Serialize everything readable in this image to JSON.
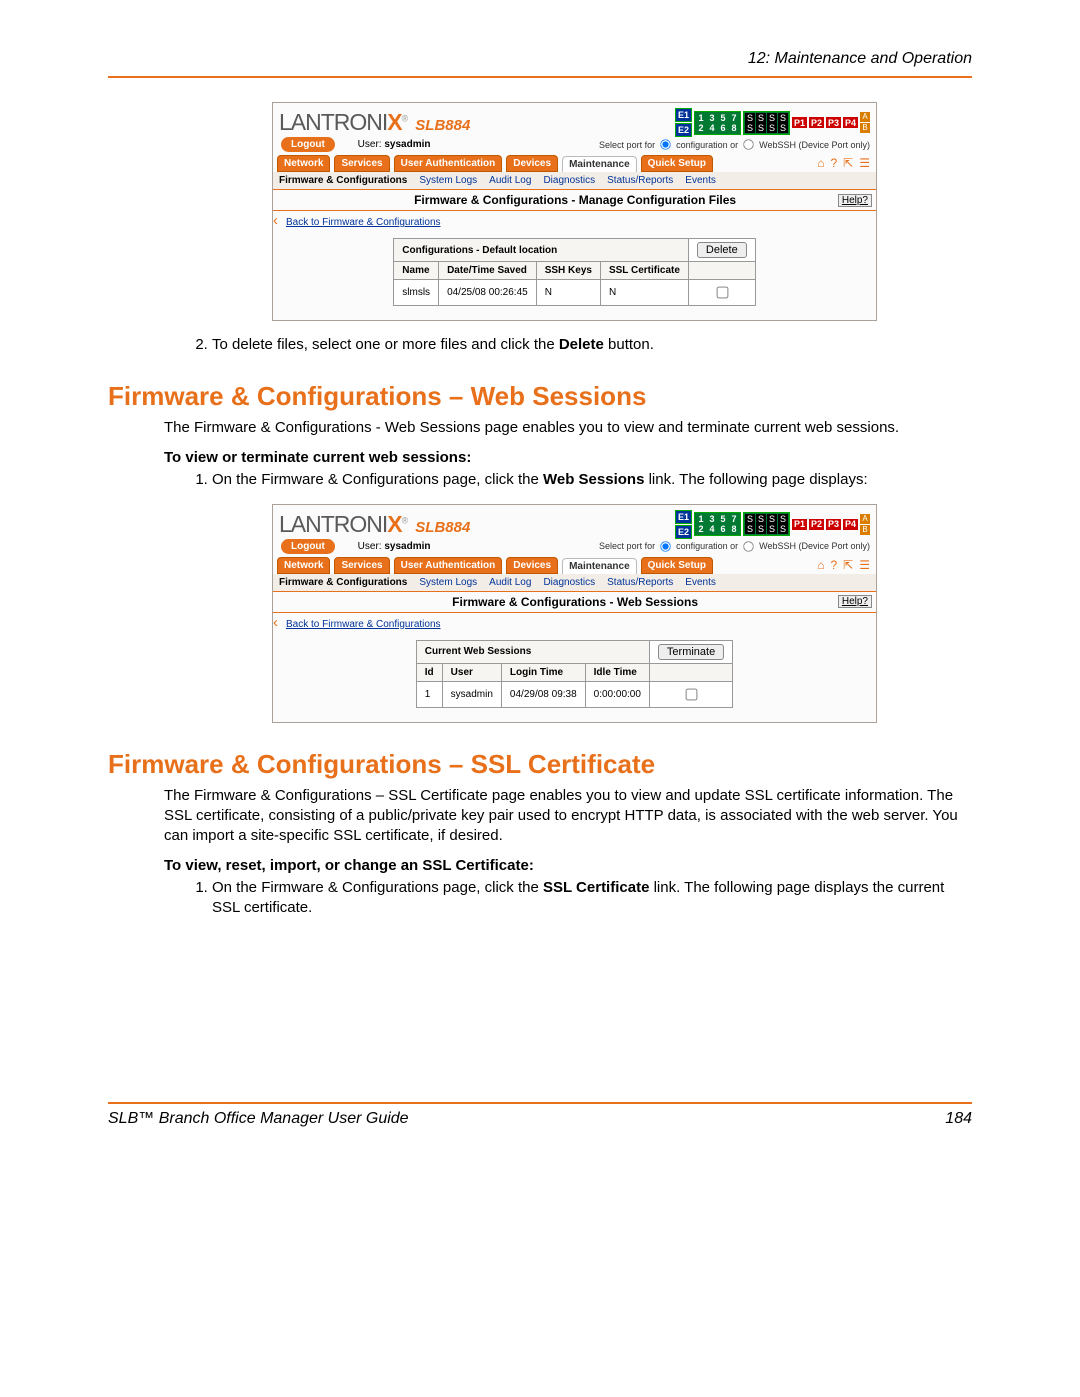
{
  "header": {
    "chapter": "12: Maintenance and Operation"
  },
  "footer": {
    "title": "SLB™ Branch Office Manager User Guide",
    "page": "184"
  },
  "fig1": {
    "brand": "LANTRONI",
    "brand_suffix": "X",
    "model": "SLB884",
    "e": [
      "E1",
      "E2"
    ],
    "ports_odd": [
      "1",
      "3",
      "5",
      "7"
    ],
    "ports_even": [
      "2",
      "4",
      "6",
      "8"
    ],
    "s_row": [
      "S",
      "S",
      "S",
      "S"
    ],
    "p_ports": [
      "P1",
      "P2",
      "P3",
      "P4"
    ],
    "ab": [
      "A",
      "B"
    ],
    "logout": "Logout",
    "user_prefix": "User:",
    "user": "sysadmin",
    "portselect_prefix": "Select port for",
    "portselect_opt1": "configuration or",
    "portselect_opt2": "WebSSH (Device Port only)",
    "tabs": {
      "t1": "Network",
      "t2": "Services",
      "t3": "User Authentication",
      "t4": "Devices",
      "t5": "Maintenance",
      "t6": "Quick Setup"
    },
    "subtabs": {
      "s1": "Firmware & Configurations",
      "s2": "System Logs",
      "s3": "Audit Log",
      "s4": "Diagnostics",
      "s5": "Status/Reports",
      "s6": "Events"
    },
    "page_title": "Firmware & Configurations - Manage Configuration Files",
    "help": "Help?",
    "backlink": "Back to Firmware & Configurations",
    "table_caption": "Configurations - Default location",
    "btn_delete": "Delete",
    "cols": {
      "c1": "Name",
      "c2": "Date/Time Saved",
      "c3": "SSH Keys",
      "c4": "SSL Certificate"
    },
    "row1": {
      "name": "slmsls",
      "dt": "04/25/08 00:26:45",
      "ssh": "N",
      "ssl": "N"
    }
  },
  "step2": {
    "prefix": "To delete files, select one or more files and click the ",
    "bold": "Delete",
    "suffix": " button."
  },
  "sec1": {
    "heading": "Firmware & Configurations – Web Sessions",
    "intro": "The Firmware & Configurations - Web Sessions page enables you to view and terminate current web sessions.",
    "sub": "To view or terminate current web sessions:",
    "li1_a": "On the Firmware & Configurations page, click the ",
    "li1_b": "Web Sessions",
    "li1_c": " link. The following page displays:"
  },
  "fig2": {
    "brand": "LANTRONI",
    "brand_suffix": "X",
    "model": "SLB884",
    "logout": "Logout",
    "user_prefix": "User:",
    "user": "sysadmin",
    "portselect_prefix": "Select port for",
    "portselect_opt1": "configuration or",
    "portselect_opt2": "WebSSH (Device Port only)",
    "page_title": "Firmware & Configurations - Web Sessions",
    "help": "Help?",
    "backlink": "Back to Firmware & Configurations",
    "table_caption": "Current Web Sessions",
    "btn_terminate": "Terminate",
    "cols": {
      "c1": "Id",
      "c2": "User",
      "c3": "Login Time",
      "c4": "Idle Time"
    },
    "row1": {
      "id": "1",
      "user": "sysadmin",
      "login": "04/29/08 09:38",
      "idle": "0:00:00:00"
    }
  },
  "sec2": {
    "heading": "Firmware & Configurations – SSL Certificate",
    "intro": "The Firmware & Configurations – SSL Certificate page enables you to view and update SSL certificate information. The SSL certificate, consisting of a public/private key pair used to encrypt HTTP data, is associated with the web server. You can import a site-specific SSL certificate, if desired.",
    "sub": "To view, reset, import, or change an SSL Certificate:",
    "li1_a": "On the Firmware & Configurations page, click the ",
    "li1_b": "SSL Certificate",
    "li1_c": " link. The following page displays the current SSL certificate."
  }
}
